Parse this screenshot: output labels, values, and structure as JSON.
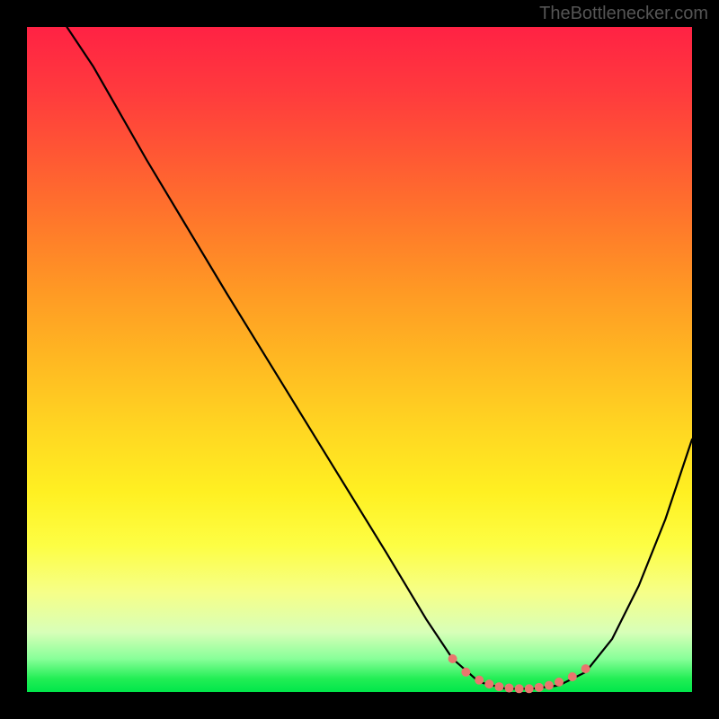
{
  "attribution": "TheBottlenecker.com",
  "chart_data": {
    "type": "line",
    "title": "",
    "xlabel": "",
    "ylabel": "",
    "xlim": [
      0,
      100
    ],
    "ylim": [
      0,
      100
    ],
    "series": [
      {
        "name": "curve",
        "stroke": "#000000",
        "stroke_width": 2.2,
        "points": [
          {
            "x": 6,
            "y": 100
          },
          {
            "x": 10,
            "y": 94
          },
          {
            "x": 14,
            "y": 87
          },
          {
            "x": 18,
            "y": 80
          },
          {
            "x": 24,
            "y": 70
          },
          {
            "x": 30,
            "y": 60
          },
          {
            "x": 38,
            "y": 47
          },
          {
            "x": 46,
            "y": 34
          },
          {
            "x": 54,
            "y": 21
          },
          {
            "x": 60,
            "y": 11
          },
          {
            "x": 64,
            "y": 5
          },
          {
            "x": 68,
            "y": 1.5
          },
          {
            "x": 72,
            "y": 0.5
          },
          {
            "x": 76,
            "y": 0.5
          },
          {
            "x": 80,
            "y": 1
          },
          {
            "x": 84,
            "y": 3
          },
          {
            "x": 88,
            "y": 8
          },
          {
            "x": 92,
            "y": 16
          },
          {
            "x": 96,
            "y": 26
          },
          {
            "x": 100,
            "y": 38
          }
        ]
      }
    ],
    "markers": [
      {
        "name": "dot",
        "color": "#e9766e",
        "r": 5,
        "points": [
          {
            "x": 64,
            "y": 5
          },
          {
            "x": 66,
            "y": 3
          },
          {
            "x": 68,
            "y": 1.8
          },
          {
            "x": 69.5,
            "y": 1.2
          },
          {
            "x": 71,
            "y": 0.8
          },
          {
            "x": 72.5,
            "y": 0.6
          },
          {
            "x": 74,
            "y": 0.5
          },
          {
            "x": 75.5,
            "y": 0.5
          },
          {
            "x": 77,
            "y": 0.7
          },
          {
            "x": 78.5,
            "y": 1
          },
          {
            "x": 80,
            "y": 1.5
          },
          {
            "x": 82,
            "y": 2.3
          },
          {
            "x": 84,
            "y": 3.5
          }
        ]
      }
    ],
    "background_gradient": {
      "type": "vertical",
      "stops": [
        {
          "pos": 0,
          "color": "#ff2244"
        },
        {
          "pos": 50,
          "color": "#ffb822"
        },
        {
          "pos": 78,
          "color": "#fdfe44"
        },
        {
          "pos": 100,
          "color": "#00e64a"
        }
      ]
    }
  }
}
